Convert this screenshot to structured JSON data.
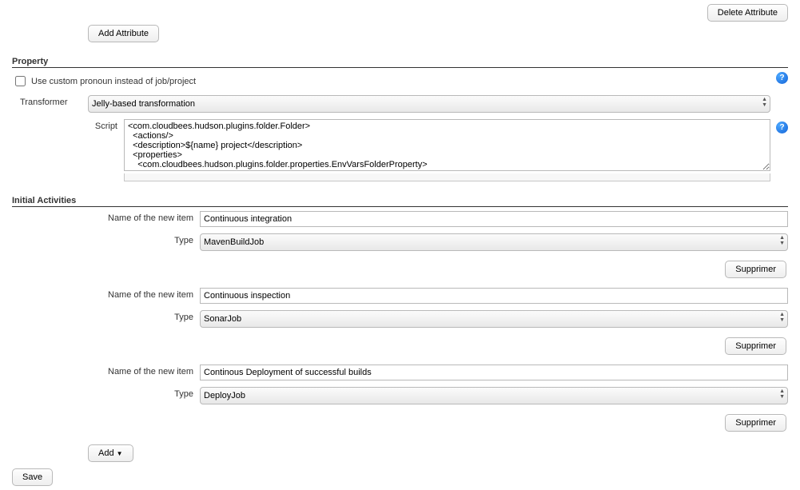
{
  "top": {
    "delete_attr": "Delete Attribute"
  },
  "add_attr": {
    "label": "Add Attribute"
  },
  "property": {
    "heading": "Property",
    "checkbox_label": "Use custom pronoun instead of job/project",
    "transformer_label": "Transformer",
    "transformer_value": "Jelly-based transformation",
    "script_label": "Script",
    "script_value": "<com.cloudbees.hudson.plugins.folder.Folder>\n  <actions/>\n  <description>${name} project</description>\n  <properties>\n    <com.cloudbees.hudson.plugins.folder.properties.EnvVarsFolderProperty>"
  },
  "initial": {
    "heading": "Initial Activities",
    "name_label": "Name of the new item",
    "type_label": "Type",
    "delete_label": "Supprimer",
    "items": [
      {
        "name": "Continuous integration",
        "type": "MavenBuildJob"
      },
      {
        "name": "Continuous inspection",
        "type": "SonarJob"
      },
      {
        "name": "Continous Deployment of successful builds",
        "type": "DeployJob"
      }
    ],
    "add_label": "Add"
  },
  "save_label": "Save"
}
